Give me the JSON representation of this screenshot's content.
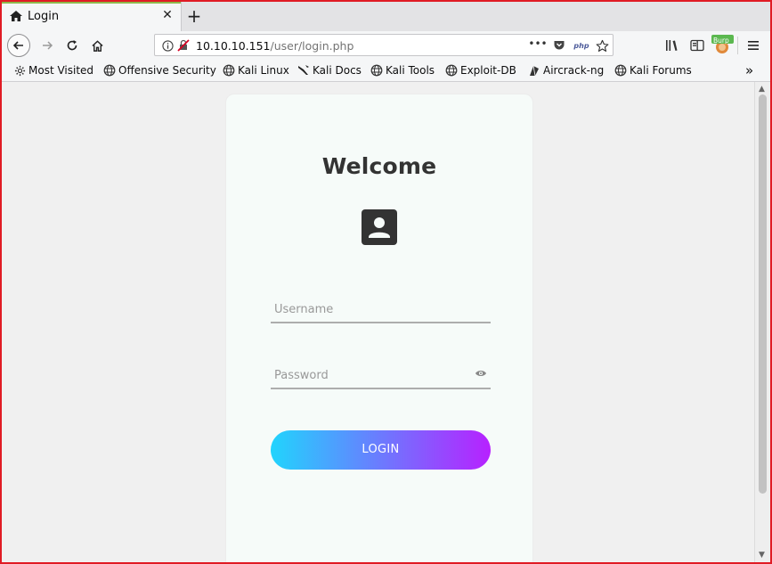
{
  "tab": {
    "title": "Login",
    "icon": "home-icon"
  },
  "navbar": {
    "url_host": "10.10.10.151",
    "url_path": "/user/login.php",
    "page_actions": "•••",
    "php_badge": "php",
    "burp_badge": "Burp"
  },
  "bookmarks": [
    {
      "label": "Most Visited",
      "icon": "gear-icon"
    },
    {
      "label": "Offensive Security",
      "icon": "globe-icon"
    },
    {
      "label": "Kali Linux",
      "icon": "globe-icon"
    },
    {
      "label": "Kali Docs",
      "icon": "kali-dragon-icon"
    },
    {
      "label": "Kali Tools",
      "icon": "globe-icon"
    },
    {
      "label": "Exploit-DB",
      "icon": "globe-icon"
    },
    {
      "label": "Aircrack-ng",
      "icon": "aircrack-icon"
    },
    {
      "label": "Kali Forums",
      "icon": "globe-icon"
    }
  ],
  "bookmarks_overflow": "»",
  "login": {
    "heading": "Welcome",
    "username_placeholder": "Username",
    "password_placeholder": "Password",
    "button_label": "LOGIN"
  },
  "colors": {
    "gradient_start": "#21d4fd",
    "gradient_end": "#b721ff",
    "frame_border": "#e01b24"
  }
}
